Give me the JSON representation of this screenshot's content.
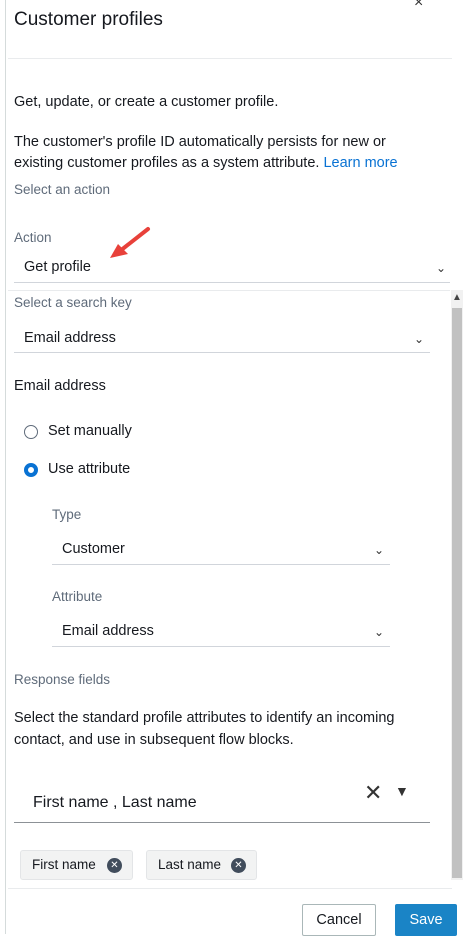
{
  "header": {
    "title": "Customer profiles",
    "close_glyph": "×"
  },
  "intro": {
    "line1": "Get, update, or create a customer profile.",
    "line2a": "The customer's profile ID automatically persists for new or",
    "line2b": "existing customer profiles as a system attribute.",
    "learn_more": "Learn more"
  },
  "select_action": {
    "section_label": "Select an action",
    "action_label": "Action",
    "action_value": "Get profile"
  },
  "search_key": {
    "label": "Select a search key",
    "value": "Email address"
  },
  "email_address": {
    "heading": "Email address",
    "radio_manual": "Set manually",
    "radio_attribute": "Use attribute",
    "selected": "Use attribute",
    "type_label": "Type",
    "type_value": "Customer",
    "attribute_label": "Attribute",
    "attribute_value": "Email address"
  },
  "response_fields": {
    "label": "Response fields",
    "desc_line1": "Select the standard profile attributes to identify an incoming",
    "desc_line2": "contact, and use in subsequent flow blocks.",
    "multiselect_value": "First name , Last name",
    "tokens": [
      "First name",
      "Last name"
    ]
  },
  "footer": {
    "cancel_label": "Cancel",
    "save_label": "Save"
  },
  "icons": {
    "chevron": "chevron-down-icon",
    "clear": "clear-icon",
    "caret": "caret-down-icon",
    "token_dismiss": "remove-token-icon",
    "annotation": "red-arrow-icon",
    "scroll_up": "scroll-up-icon"
  },
  "colors": {
    "accent": "#0972d3",
    "save_button": "#1a84c6",
    "annotation_arrow": "#e8413a"
  }
}
